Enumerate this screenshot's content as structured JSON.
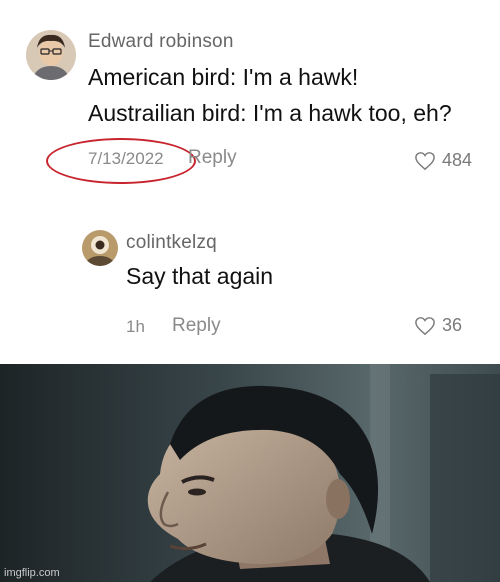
{
  "comment1": {
    "username": "Edward robinson",
    "lines": [
      "American bird: I'm a hawk!",
      "Austrailian bird: I'm a hawk too, eh?"
    ],
    "date": "7/13/2022",
    "reply_label": "Reply",
    "like_count": "484"
  },
  "comment2": {
    "username": "colintkelzq",
    "text": "Say that again",
    "time": "1h",
    "reply_label": "Reply",
    "like_count": "36"
  },
  "watermark": "imgflip.com",
  "colors": {
    "annotation_circle": "#c8242d",
    "meta_gray": "#8a8a8a",
    "text": "#111111"
  },
  "icons": [
    "heart-outline-icon"
  ]
}
